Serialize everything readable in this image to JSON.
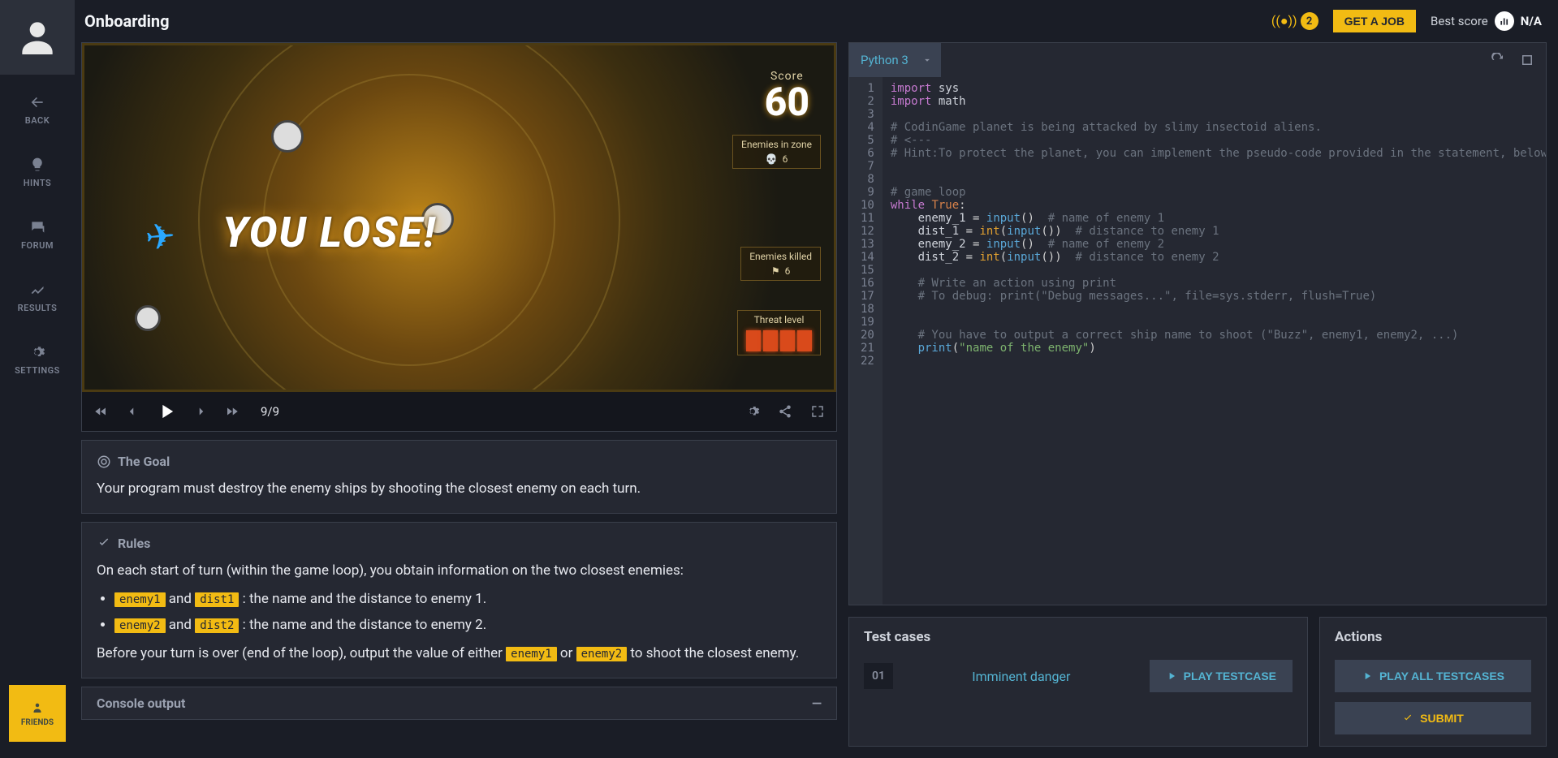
{
  "title": "Onboarding",
  "topbar": {
    "broadcast_count": "2",
    "get_job": "GET A JOB",
    "best_score_label": "Best score",
    "best_score_value": "N/A"
  },
  "sidebar": {
    "back": "BACK",
    "hints": "HINTS",
    "forum": "FORUM",
    "results": "RESULTS",
    "settings": "SETTINGS",
    "friends": "FRIENDS"
  },
  "game": {
    "lose": "YOU LOSE!",
    "score_label": "Score",
    "score_value": "60",
    "hud_zone": "Enemies in zone",
    "hud_zone_val": "6",
    "hud_killed": "Enemies killed",
    "hud_killed_val": "6",
    "hud_threat": "Threat level",
    "frame": "9/9"
  },
  "statement": {
    "goal_head": "The Goal",
    "goal_body": "Your program must destroy the enemy ships by shooting the closest enemy on each turn.",
    "rules_head": "Rules",
    "rules_intro": "On each start of turn (within the game loop), you obtain information on the two closest enemies:",
    "bullet1_a": "enemy1",
    "bullet1_mid": " and ",
    "bullet1_b": "dist1",
    "bullet1_tail": " : the name and the distance to enemy 1.",
    "bullet2_a": "enemy2",
    "bullet2_mid": " and ",
    "bullet2_b": "dist2",
    "bullet2_tail": " : the name and the distance to enemy 2.",
    "rules_out_pre": "Before your turn is over (end of the loop), output the value of either ",
    "rules_out_a": "enemy1",
    "rules_out_mid": " or ",
    "rules_out_b": "enemy2",
    "rules_out_post": " to shoot the closest enemy.",
    "console": "Console output"
  },
  "editor": {
    "language": "Python 3",
    "lines": [
      "1",
      "2",
      "3",
      "4",
      "5",
      "6",
      "7",
      "8",
      "9",
      "10",
      "11",
      "12",
      "13",
      "14",
      "15",
      "16",
      "17",
      "18",
      "19",
      "20",
      "21",
      "22"
    ]
  },
  "testcases": {
    "head": "Test cases",
    "num": "01",
    "name": "Imminent danger",
    "play": "PLAY TESTCASE"
  },
  "actions": {
    "head": "Actions",
    "play_all": "PLAY ALL TESTCASES",
    "submit": "SUBMIT"
  }
}
